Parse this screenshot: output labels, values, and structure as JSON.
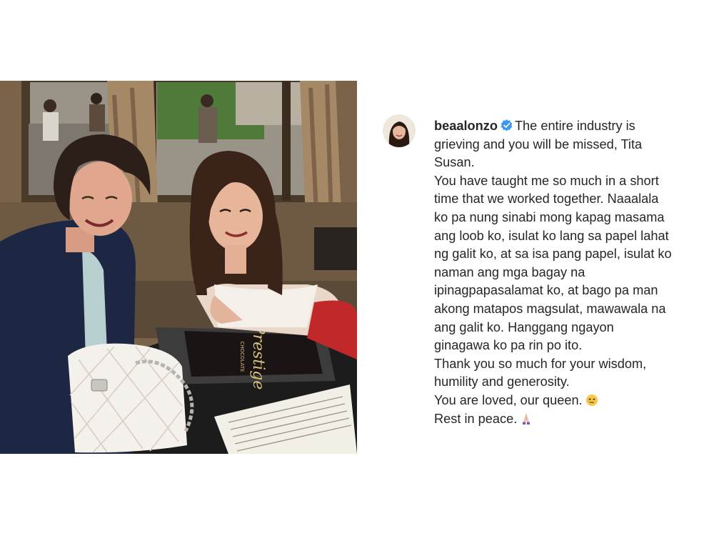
{
  "post": {
    "username": "beaalonzo",
    "verified": true,
    "emojis": [
      "crying-face-icon",
      "praying-hands-icon"
    ],
    "caption_lines": [
      "The entire industry is",
      "grieving and you will be missed, Tita",
      "Susan.",
      "You have taught me so much in a short",
      "time that we worked together. Naaalala",
      "ko pa nung sinabi mong kapag masama",
      "ang loob ko, isulat ko lang sa papel lahat",
      "ng galit ko, at sa isa pang papel, isulat ko",
      "naman ang mga bagay na",
      "ipinagpapasalamat ko, at bago pa man",
      "akong matapos magsulat, mawawala na",
      "ang galit ko. Hanggang ngayon",
      "ginagawa ko pa rin po ito.",
      "Thank you so much for your wisdom,",
      "humility and generosity.",
      "You are loved, our queen.",
      "Rest in peace."
    ]
  },
  "photo": {
    "menu_text": "Prestige",
    "menu_subtext": "CHOCOLATE"
  },
  "colors": {
    "text": "#262626",
    "verified_blue": "#3897f0"
  }
}
